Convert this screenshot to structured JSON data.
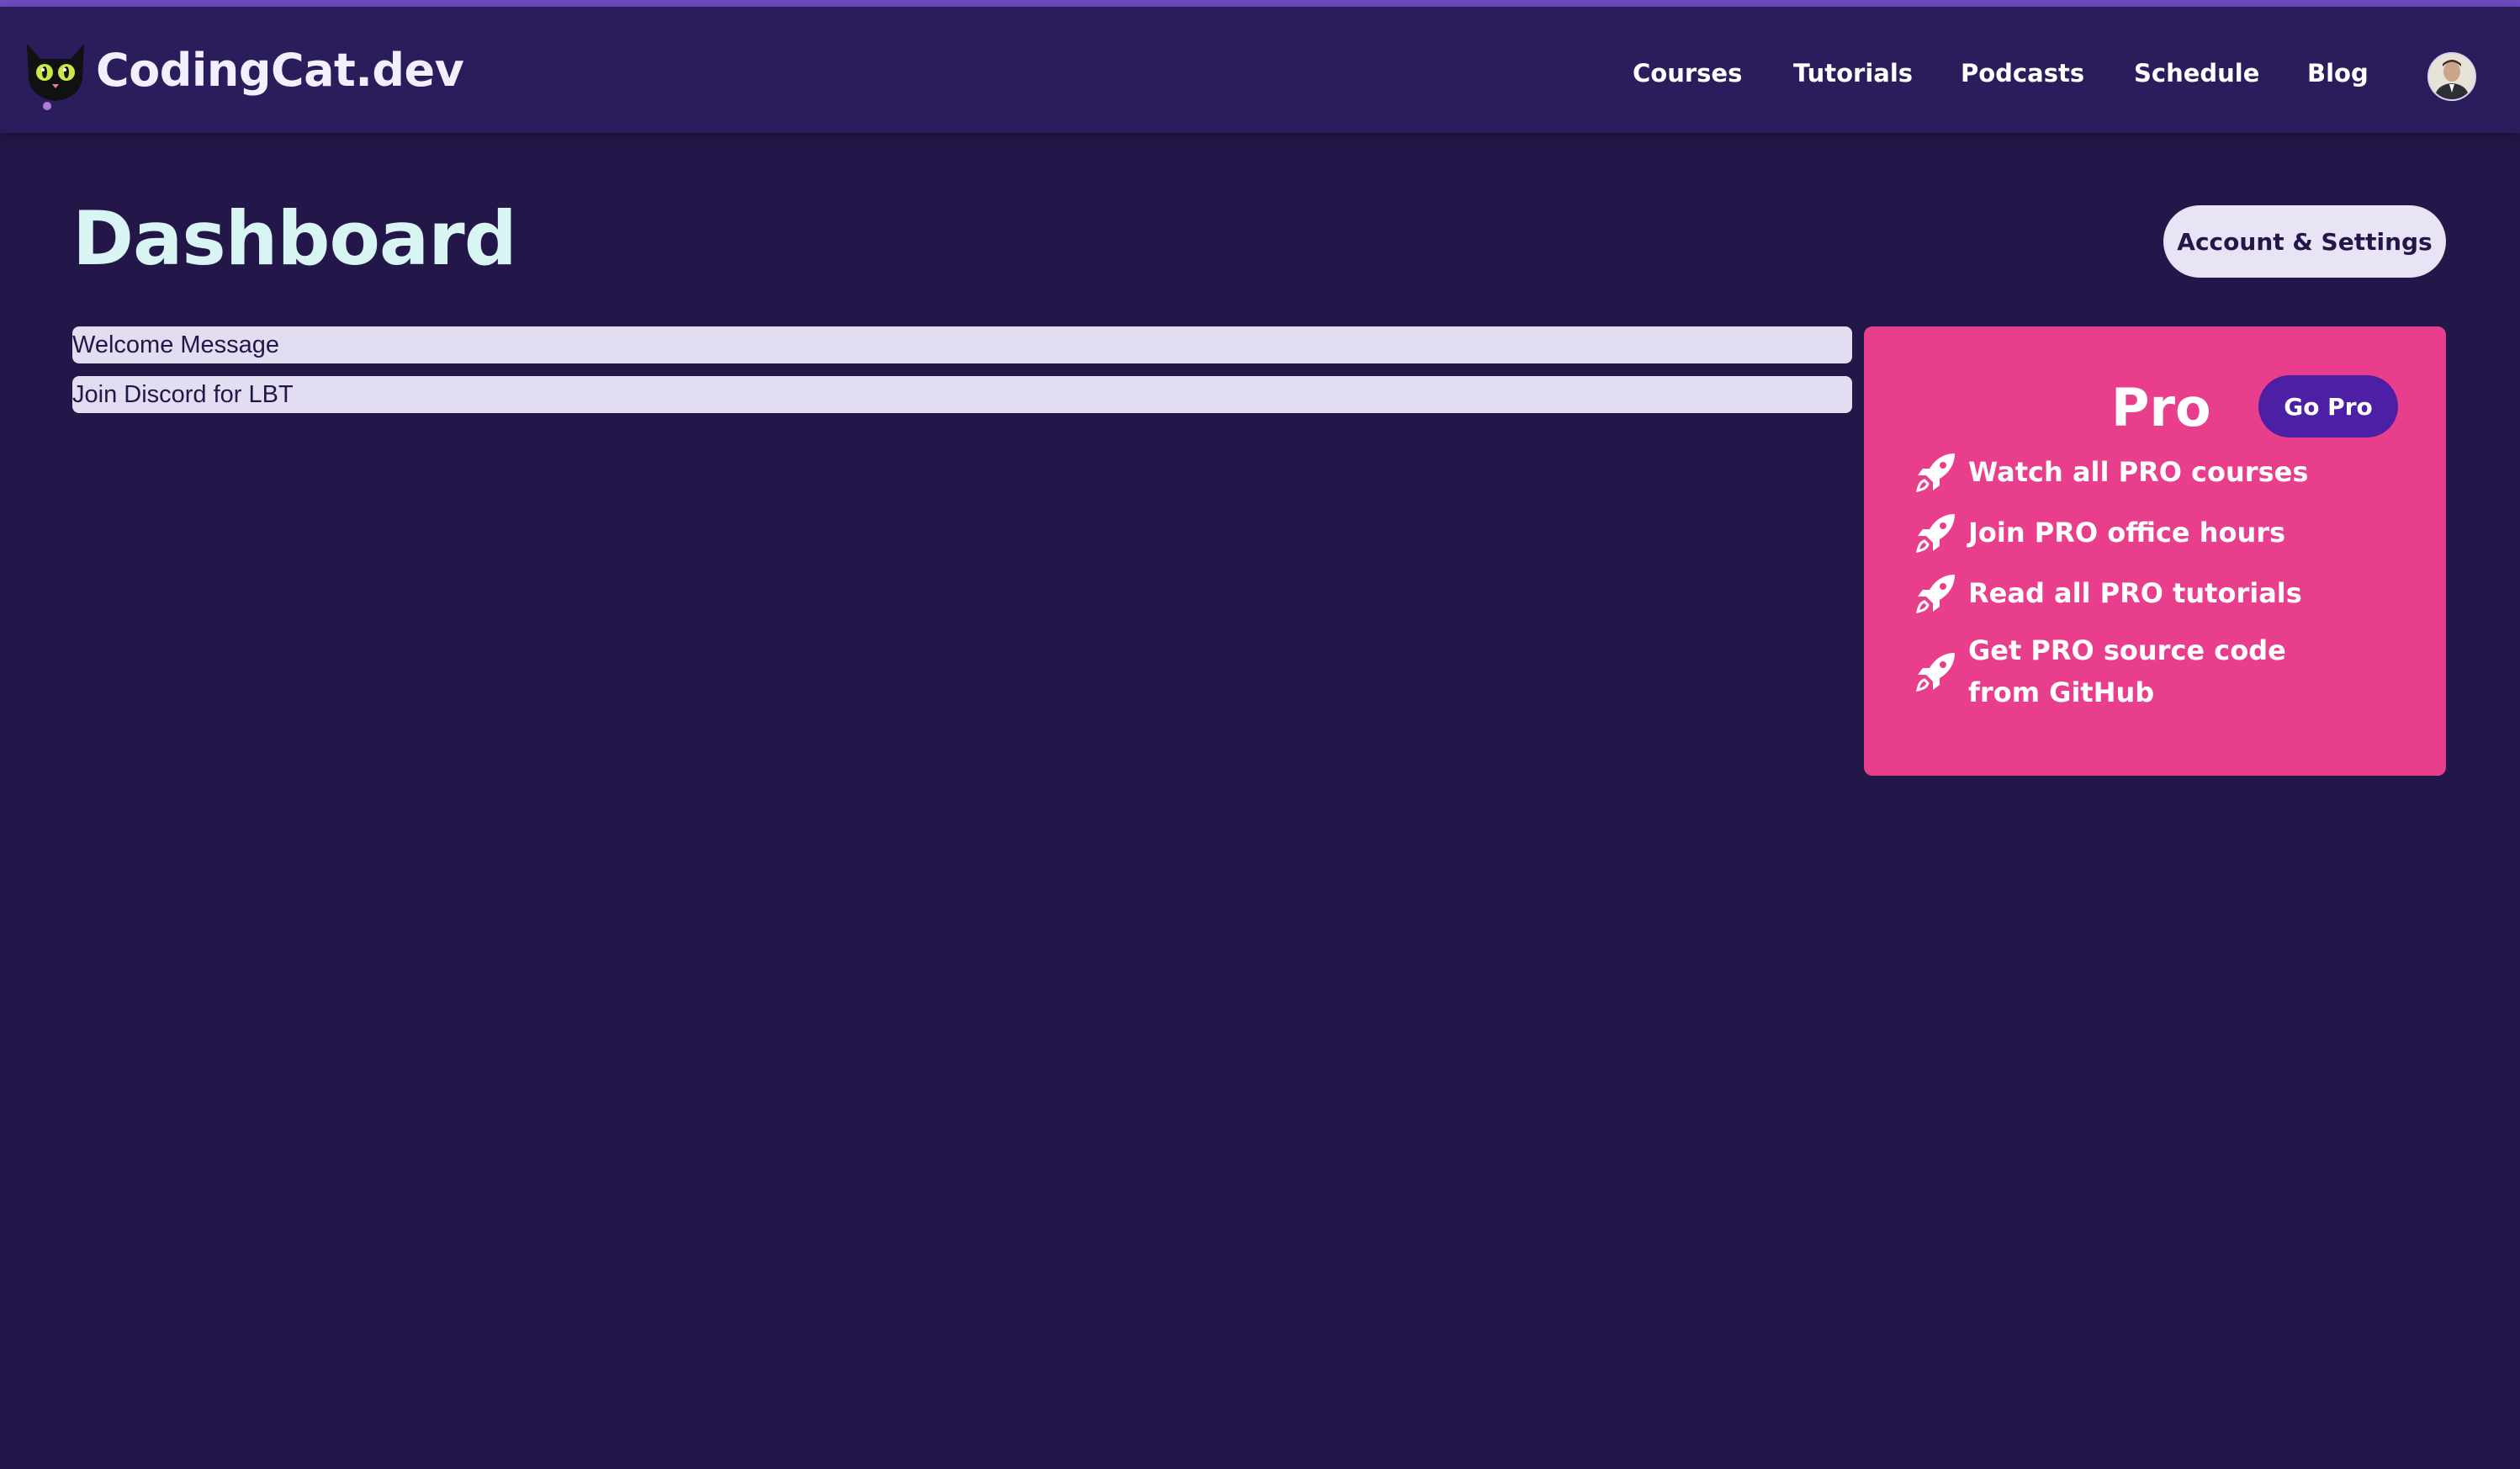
{
  "header": {
    "brand": "CodingCat.dev",
    "nav": [
      "Courses",
      "Tutorials",
      "Podcasts",
      "Schedule",
      "Blog"
    ]
  },
  "main": {
    "title": "Dashboard",
    "settings_button": "Account & Settings",
    "messages": [
      "Welcome Message",
      "Join Discord for LBT"
    ]
  },
  "pro": {
    "title": "Pro",
    "button": "Go Pro",
    "features": [
      "Watch all PRO courses",
      "Join PRO office hours",
      "Read all PRO tutorials",
      "Get PRO source code from GitHub"
    ]
  },
  "colors": {
    "background": "#221748",
    "header": "#2b1c5c",
    "pro_card": "#e83e8c",
    "go_pro": "#4c1fa5",
    "title": "#d8f5f3"
  },
  "icons": {
    "logo": "cat-logo-icon",
    "feature": "rocket-icon",
    "avatar": "user-avatar"
  }
}
